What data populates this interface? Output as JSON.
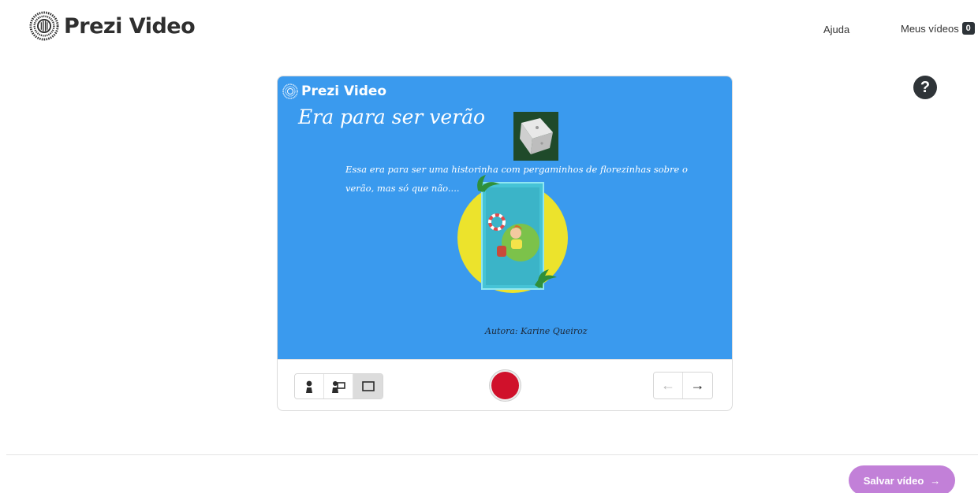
{
  "header": {
    "logo_text": "Prezi Video",
    "nav": {
      "help_label": "Ajuda",
      "my_videos_label": "Meus vídeos",
      "my_videos_count": "0"
    }
  },
  "help_button": {
    "label": "?"
  },
  "slide": {
    "brand_text": "Prezi Video",
    "title": "Era para ser verão",
    "body": "Essa era para ser uma historinha com pergaminhos de florezinhas sobre o verão, mas só que não....",
    "author": "Autora: Karine Queiroz",
    "background_color": "#3a9aee"
  },
  "controls": {
    "modes": [
      "person-icon",
      "person-with-screen-icon",
      "screen-only-icon"
    ],
    "active_mode": "screen-only-icon",
    "prev_arrow": "←",
    "next_arrow": "→"
  },
  "footer": {
    "save_label": "Salvar vídeo",
    "save_arrow": "→"
  },
  "colors": {
    "record": "#d0112b",
    "save_button": "#c280d8",
    "slide_bg": "#3a9aee"
  }
}
